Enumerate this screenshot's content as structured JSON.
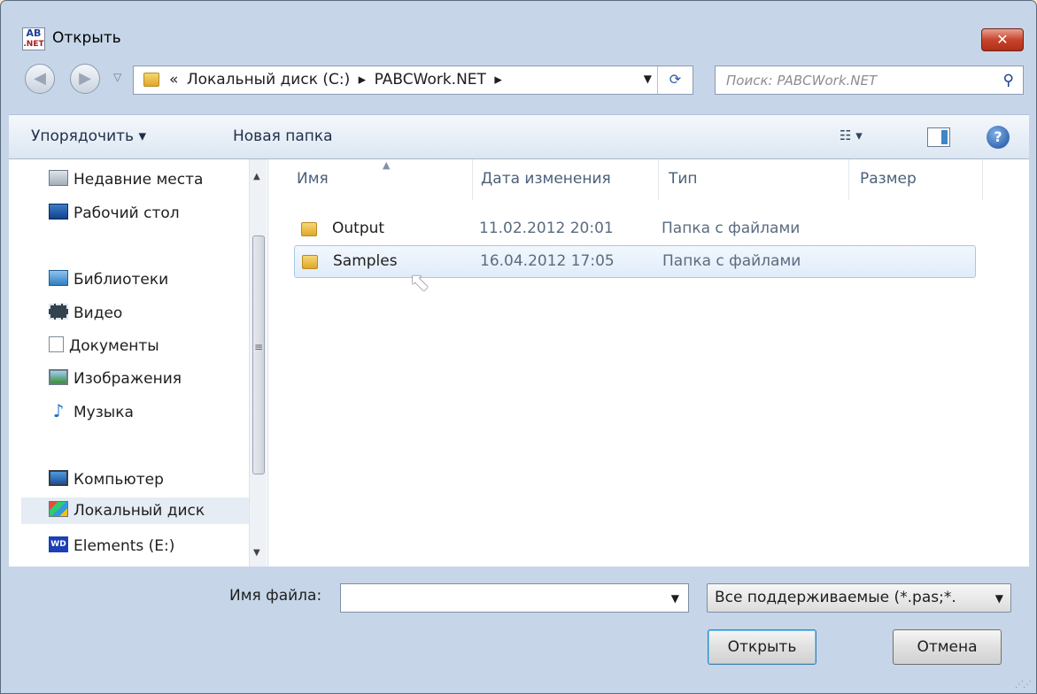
{
  "window": {
    "title": "Открыть",
    "app_icon_text_top": "AB",
    "app_icon_text_bottom": ".NET",
    "close_glyph": "✕"
  },
  "navbar": {
    "back_glyph": "◀",
    "forward_glyph": "▶",
    "breadcrumb_prefix": "«",
    "breadcrumbs": [
      "Локальный диск (C:)",
      "PABCWork.NET"
    ],
    "breadcrumb_separator": "▸",
    "search_placeholder": "Поиск: PABCWork.NET"
  },
  "toolbar": {
    "organize_label": "Упорядочить ▾",
    "new_folder_label": "Новая папка",
    "view_glyph": "☷ ▾",
    "help_glyph": "?"
  },
  "sidebar": {
    "items": [
      {
        "label": "Недавние места",
        "icon": "recent-places-icon"
      },
      {
        "label": "Рабочий стол",
        "icon": "desktop-icon"
      },
      {
        "label": "Библиотеки",
        "icon": "libraries-icon"
      },
      {
        "label": "Видео",
        "icon": "video-icon"
      },
      {
        "label": "Документы",
        "icon": "documents-icon"
      },
      {
        "label": "Изображения",
        "icon": "pictures-icon"
      },
      {
        "label": "Музыка",
        "icon": "music-icon"
      },
      {
        "label": "Компьютер",
        "icon": "computer-icon"
      },
      {
        "label": "Локальный диск",
        "icon": "local-disk-icon",
        "selected": true
      },
      {
        "label": "Elements (E:)",
        "icon": "wd-drive-icon"
      }
    ]
  },
  "filelist": {
    "columns": [
      "Имя",
      "Дата изменения",
      "Тип",
      "Размер"
    ],
    "sort_column": "Имя",
    "rows": [
      {
        "name": "Output",
        "date": "11.02.2012 20:01",
        "type": "Папка с файлами",
        "size": ""
      },
      {
        "name": "Samples",
        "date": "16.04.2012 17:05",
        "type": "Папка с файлами",
        "size": "",
        "selected": true
      }
    ]
  },
  "bottom": {
    "filename_label": "Имя файла:",
    "filename_value": "",
    "filter_value": "Все поддерживаемые (*.pas;*.",
    "open_label": "Открыть",
    "cancel_label": "Отмена"
  },
  "colors": {
    "page_background": "#fbe5c8",
    "window_frame": "#c6d6e8",
    "close_button": "#c7452d",
    "selection": "#e0ecfa"
  }
}
